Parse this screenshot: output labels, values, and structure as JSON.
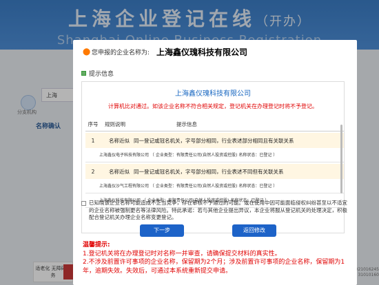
{
  "background": {
    "title_cn": "上海企业登记在线",
    "title_cn_suffix": "（开办）",
    "title_en": "Shanghai Online Business Registration（Establishment）",
    "side_label": "分支机构",
    "search_value": "上海",
    "section_label": "名称确认",
    "bottom_left_label": "适老化 无障碍服务",
    "right_digits_1": "021016245",
    "right_digits_2": "31010160"
  },
  "dialog": {
    "name_label": "您申报的企业名称为:",
    "name_value": "上海鑫仪瑰科技有限公司",
    "hint_label": "提示信息",
    "card_title": "上海鑫仪瑰科技有限公司",
    "card_alert": "计算机比对通过。如该企业名称不符合相关规定，登记机关在办理登记时将不予登记。",
    "table": {
      "headers": [
        "序号",
        "规则说明",
        "提示信息"
      ],
      "rows": [
        {
          "num": "1",
          "rule": "名称近似",
          "info": "同一登记或冠名机关，字号部分相同，行业表述部分相同且有关联关系",
          "sub": "上海鑫仪电子科技有限公司 （ 企业类型：有限责任公司(自然人投资或控股) 名称状态：已登记 ）"
        },
        {
          "num": "2",
          "rule": "名称近似",
          "info": "同一登记或冠名机关，字号部分相同，行业表述不同但有关联关系",
          "sub": "上海鑫仪沙气工程有限公司 （ 企业类型：有限责任公司(自然人投资或控股) 名称状态：已登记 ）"
        }
      ],
      "trailing_sub": "上海鑫仪科技有限公司 （ 企业类型：有限责任公司(自然人投资或控股) 名称状态：已登记 ）"
    },
    "consent_text": "已知晓该企业名称可能造成不正当竞争，存在审核不予通过的可能。或在使用中因可能面临侵权纠纷甚至以不适宜的企业名称被强制更名等法律风险。特此承诺：若与其他企业提出异议，本企业将服从登记机关的处理决定，积极配合登记机关办理企业名称变更登记。",
    "btn_next": "下一步",
    "btn_back": "返回修改",
    "tips_head": "温馨提示:",
    "tips": [
      "1.登记机关将在办理登记时对名称一并审查，请确保提交材料的真实性。",
      "2.不涉及前置许可事项的企业名称，保留期为2个月；涉及前置许可事项的企业名称，保留期为1年，逾期失效。失效后，可通过本系统重新提交申请。"
    ]
  }
}
